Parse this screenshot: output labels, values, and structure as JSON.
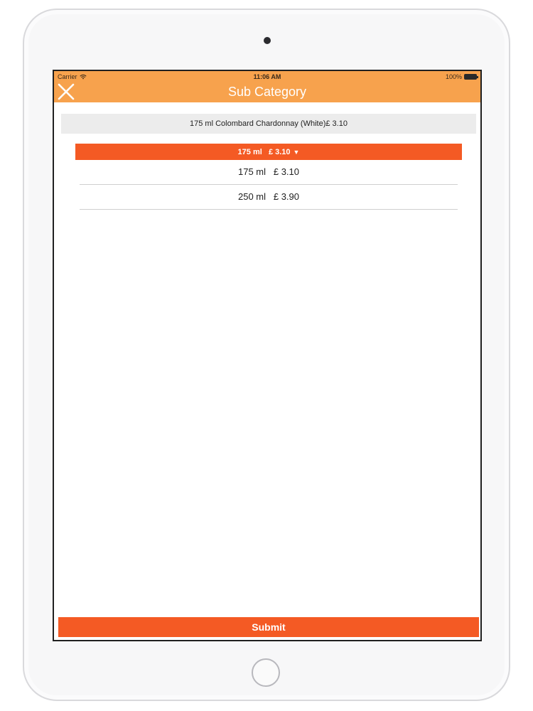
{
  "status_bar": {
    "carrier": "Carrier",
    "time": "11:06 AM",
    "battery": "100%"
  },
  "nav": {
    "title": "Sub Category",
    "close_icon": "close-icon",
    "background_color": "#f7a24d"
  },
  "item": {
    "description": "175 ml Colombard Chardonnay (White)£ 3.10"
  },
  "dropdown": {
    "selected": "175 ml   £ 3.10",
    "caret": "▼",
    "accent_color": "#f45a24",
    "options": [
      {
        "label": "175 ml   £ 3.10"
      },
      {
        "label": "250 ml   £ 3.90"
      }
    ]
  },
  "submit": {
    "label": "Submit"
  }
}
